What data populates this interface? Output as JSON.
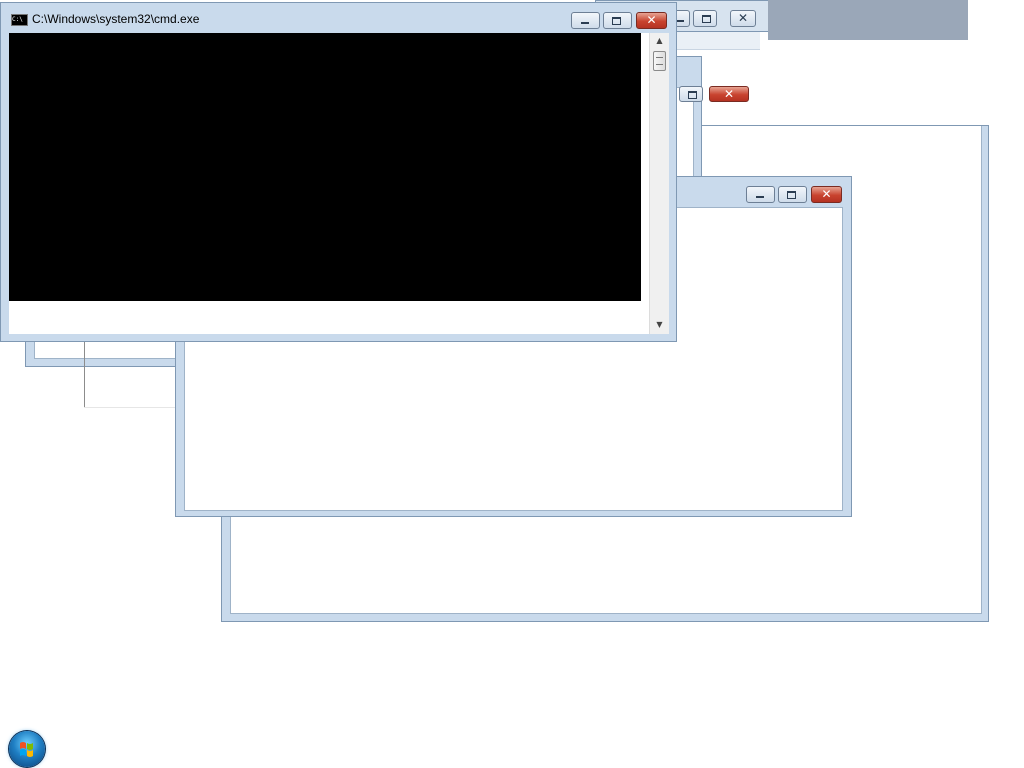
{
  "cmd_window": {
    "title": "C:\\Windows\\system32\\cmd.exe",
    "icon_label": "C:\\",
    "scroll_up": "▲",
    "scroll_down": "▼"
  },
  "caption_buttons": {
    "close_glyph": "✕"
  }
}
